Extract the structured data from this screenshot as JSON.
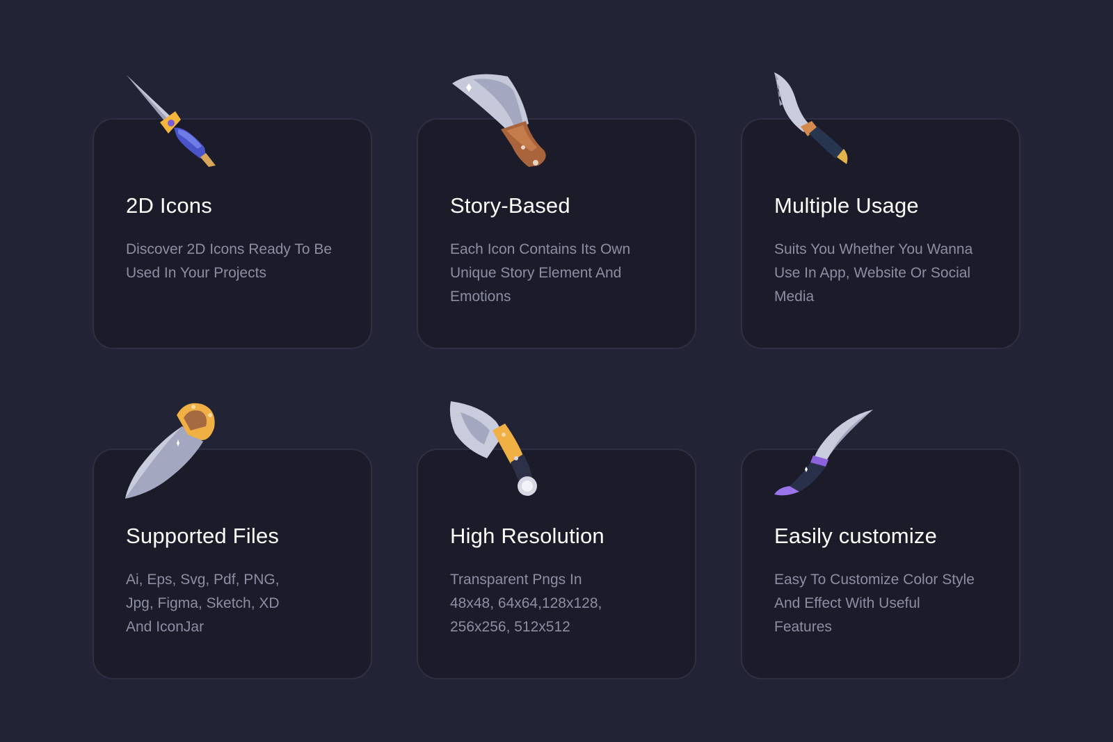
{
  "cards": [
    {
      "title": "2D Icons",
      "icon": "dagger-blue-handle-icon",
      "lines": [
        "Discover 2D Icons Ready To Be",
        "Used In Your Projects"
      ]
    },
    {
      "title": "Story-Based",
      "icon": "cleaver-knife-icon",
      "lines": [
        "Each Icon Contains Its Own",
        "Unique Story Element And",
        "Emotions"
      ]
    },
    {
      "title": "Multiple Usage",
      "icon": "serrated-knife-icon",
      "lines": [
        "Suits You Whether You Wanna",
        "Use In App, Website Or Social",
        "Media"
      ]
    },
    {
      "title": "Supported Files",
      "icon": "push-dagger-icon",
      "lines": [
        "Ai, Eps, Svg, Pdf, PNG,",
        "Jpg, Figma, Sketch, XD",
        "And IconJar"
      ]
    },
    {
      "title": "High Resolution",
      "icon": "hunting-knife-icon",
      "lines": [
        "Transparent Pngs In",
        "48x48, 64x64,128x128,",
        "256x256, 512x512"
      ]
    },
    {
      "title": "Easily customize",
      "icon": "curved-knife-icon",
      "lines": [
        "Easy To Customize Color Style",
        "And Effect With Useful",
        "Features"
      ]
    }
  ],
  "colors": {
    "background": "#222334",
    "card": "#1b1b29",
    "card_border": "#2e2f42",
    "title": "#ffffff",
    "description": "#8c8ea3"
  }
}
